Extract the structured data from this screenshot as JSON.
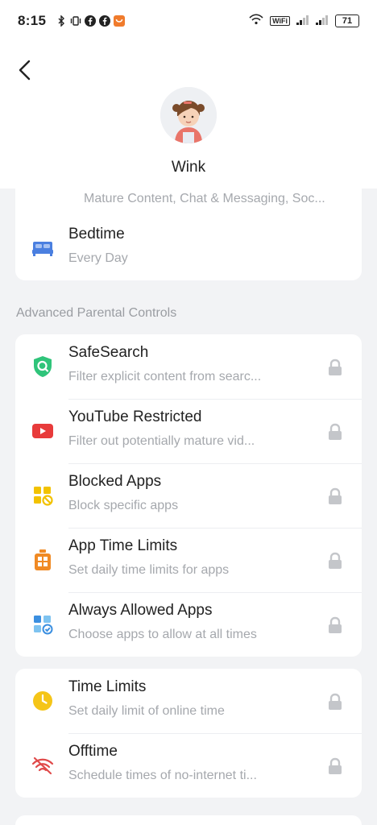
{
  "status_bar": {
    "time": "8:15",
    "wifi_label": "WiFi",
    "battery": "71"
  },
  "profile": {
    "name": "Wink"
  },
  "top_card": {
    "partial_subtitle": "Mature Content, Chat & Messaging, Soc...",
    "bedtime_title": "Bedtime",
    "bedtime_sub": "Every Day"
  },
  "section_label": "Advanced Parental Controls",
  "advanced": [
    {
      "title": "SafeSearch",
      "sub": "Filter explicit content from searc..."
    },
    {
      "title": "YouTube Restricted",
      "sub": "Filter out potentially mature vid..."
    },
    {
      "title": "Blocked Apps",
      "sub": "Block specific apps"
    },
    {
      "title": "App Time Limits",
      "sub": "Set daily time limits for apps"
    },
    {
      "title": "Always Allowed Apps",
      "sub": "Choose apps to allow at all times"
    }
  ],
  "time_card": [
    {
      "title": "Time Limits",
      "sub": "Set daily limit of online time"
    },
    {
      "title": "Offtime",
      "sub": "Schedule times of no-internet ti..."
    }
  ],
  "colors": {
    "background": "#f2f3f5",
    "safesearch": "#2fc47a",
    "youtube": "#e83b3b",
    "blocked": "#f2c200",
    "app_time": "#f08a24",
    "always": "#3b8fe0",
    "time_limits": "#f5c518",
    "offtime": "#e04a4a",
    "lock": "#c4c6ca"
  }
}
